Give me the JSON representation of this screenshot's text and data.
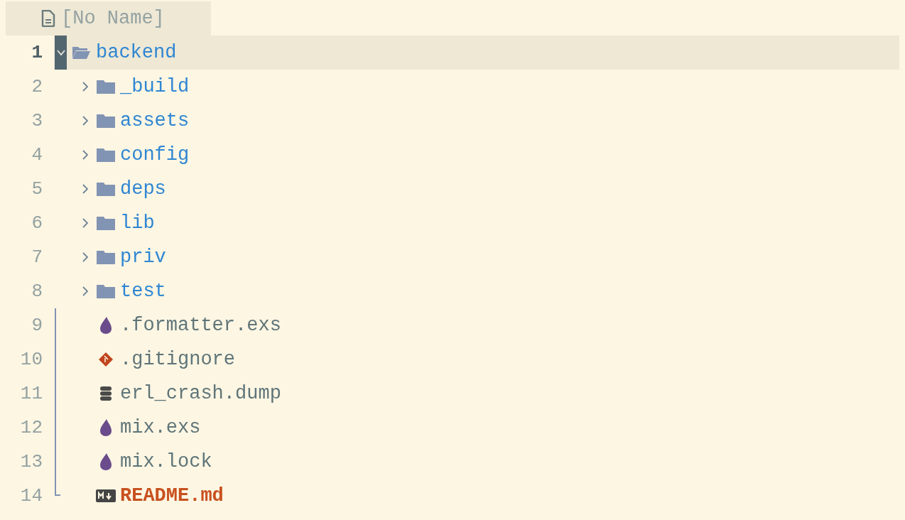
{
  "tab": {
    "title": "[No Name]"
  },
  "tree": [
    {
      "line": "1",
      "name": "backend",
      "kind": "folder",
      "expanded": true,
      "current": true,
      "color": "#2f86d2",
      "children": [
        {
          "line": "2",
          "name": "_build",
          "kind": "folder",
          "expanded": false,
          "current": false,
          "color": "#2f86d2"
        },
        {
          "line": "3",
          "name": "assets",
          "kind": "folder",
          "expanded": false,
          "current": false,
          "color": "#2f86d2"
        },
        {
          "line": "4",
          "name": "config",
          "kind": "folder",
          "expanded": false,
          "current": false,
          "color": "#2f86d2"
        },
        {
          "line": "5",
          "name": "deps",
          "kind": "folder",
          "expanded": false,
          "current": false,
          "color": "#2f86d2"
        },
        {
          "line": "6",
          "name": "lib",
          "kind": "folder",
          "expanded": false,
          "current": false,
          "color": "#2f86d2"
        },
        {
          "line": "7",
          "name": "priv",
          "kind": "folder",
          "expanded": false,
          "current": false,
          "color": "#2f86d2"
        },
        {
          "line": "8",
          "name": "test",
          "kind": "folder",
          "expanded": false,
          "current": false,
          "color": "#2f86d2"
        },
        {
          "line": "9",
          "name": ".formatter.exs",
          "kind": "elixir",
          "current": false,
          "color": "#5f7579"
        },
        {
          "line": "10",
          "name": ".gitignore",
          "kind": "git",
          "current": false,
          "color": "#5f7579"
        },
        {
          "line": "11",
          "name": "erl_crash.dump",
          "kind": "database",
          "current": false,
          "color": "#5f7579"
        },
        {
          "line": "12",
          "name": "mix.exs",
          "kind": "elixir",
          "current": false,
          "color": "#5f7579"
        },
        {
          "line": "13",
          "name": "mix.lock",
          "kind": "elixir",
          "current": false,
          "color": "#5f7579"
        },
        {
          "line": "14",
          "name": "README.md",
          "kind": "markdown",
          "current": false,
          "color": "#c8501e"
        }
      ]
    }
  ]
}
